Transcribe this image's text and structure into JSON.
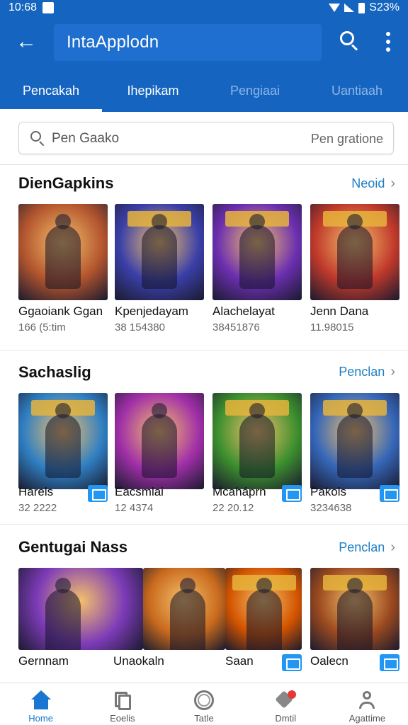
{
  "status_bar": {
    "time": "10:68",
    "battery": "S23%"
  },
  "app_bar": {
    "title": "IntaApplodn"
  },
  "tabs": [
    {
      "label": "Pencakah",
      "active": true
    },
    {
      "label": "Ihepikam",
      "active": false
    },
    {
      "label": "Pengiaai",
      "active": false
    },
    {
      "label": "Uantiaah",
      "active": false
    }
  ],
  "search": {
    "placeholder": "Pen Gaako",
    "filter_label": "Pen gratione"
  },
  "sections": [
    {
      "title": "DienGapkins",
      "link": "Neoid",
      "items": [
        {
          "name": "Ggaoiank Ggan",
          "sub": "166 (5:tim"
        },
        {
          "name": "Kpenjedayam",
          "sub": "38 154380"
        },
        {
          "name": "Alachelayat",
          "sub": "38451876"
        },
        {
          "name": "Jenn Dana",
          "sub": "11.98015"
        }
      ]
    },
    {
      "title": "Sachaslig",
      "link": "Penclan",
      "items": [
        {
          "name": "Harels",
          "sub": "32 2222"
        },
        {
          "name": "Eacsmlai",
          "sub": "12 4374"
        },
        {
          "name": "Mcaháprn",
          "sub": "22 20.12"
        },
        {
          "name": "Pakols",
          "sub": "3234638"
        }
      ]
    },
    {
      "title": "Gentugai Nass",
      "link": "Penclan",
      "items": [
        {
          "name": "Gernnam",
          "sub": ""
        },
        {
          "name": "Unaokaln",
          "sub": ""
        },
        {
          "name": "Saan",
          "sub": ""
        },
        {
          "name": "Oalecn",
          "sub": ""
        }
      ]
    }
  ],
  "bottom_nav": [
    {
      "label": "Home",
      "icon": "home-icon",
      "active": true
    },
    {
      "label": "Eoelis",
      "icon": "book-icon",
      "active": false
    },
    {
      "label": "Tatle",
      "icon": "ring-icon",
      "active": false
    },
    {
      "label": "Dmtil",
      "icon": "heart-icon",
      "active": false
    },
    {
      "label": "Agattime",
      "icon": "user-icon",
      "active": false
    }
  ],
  "colors": {
    "primary": "#1565c0",
    "accent": "#1e7fc4",
    "download_button": "#2196f3",
    "notification_dot": "#e53935"
  },
  "thumb_palettes": {
    "section_0": [
      "#b3552e",
      "#3a3fa8",
      "#6c2fb0",
      "#c0392b"
    ],
    "section_1": [
      "#2f7fc2",
      "#a02fa8",
      "#3c8f2e",
      "#3566b8"
    ],
    "section_2": [
      "#7d3bb8",
      "#c96a1d",
      "#d35400",
      "#9c4a1f"
    ]
  }
}
